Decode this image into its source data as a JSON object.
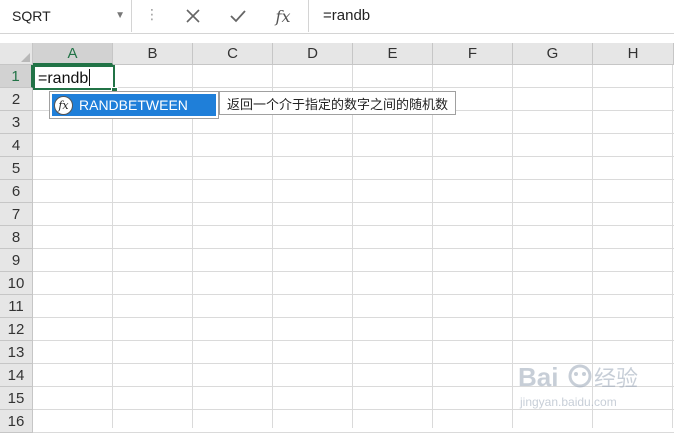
{
  "name_box": {
    "value": "SQRT"
  },
  "formula_bar": {
    "separator": "⋮",
    "cancel_icon": "close-icon",
    "enter_icon": "check-icon",
    "function_icon": "fx-icon",
    "function_label": "fx",
    "formula": "=randb"
  },
  "columns": [
    "A",
    "B",
    "C",
    "D",
    "E",
    "F",
    "G",
    "H"
  ],
  "rows": [
    "1",
    "2",
    "3",
    "4",
    "5",
    "6",
    "7",
    "8",
    "9",
    "10",
    "11",
    "12",
    "13",
    "14",
    "15",
    "16"
  ],
  "active_cell": {
    "ref": "A1",
    "text": "=randb"
  },
  "autocomplete": {
    "items": [
      {
        "icon": "fx",
        "label": "RANDBETWEEN",
        "selected": true
      }
    ],
    "tooltip": "返回一个介于指定的数字之间的随机数"
  },
  "colors": {
    "accent_green": "#217346",
    "selection_blue": "#1f7fd9",
    "grid_line": "#dadada",
    "header_bg": "#e6e6e6"
  },
  "watermark": {
    "text": "Baidu经验",
    "subtext": "jingyan.baidu.com"
  }
}
